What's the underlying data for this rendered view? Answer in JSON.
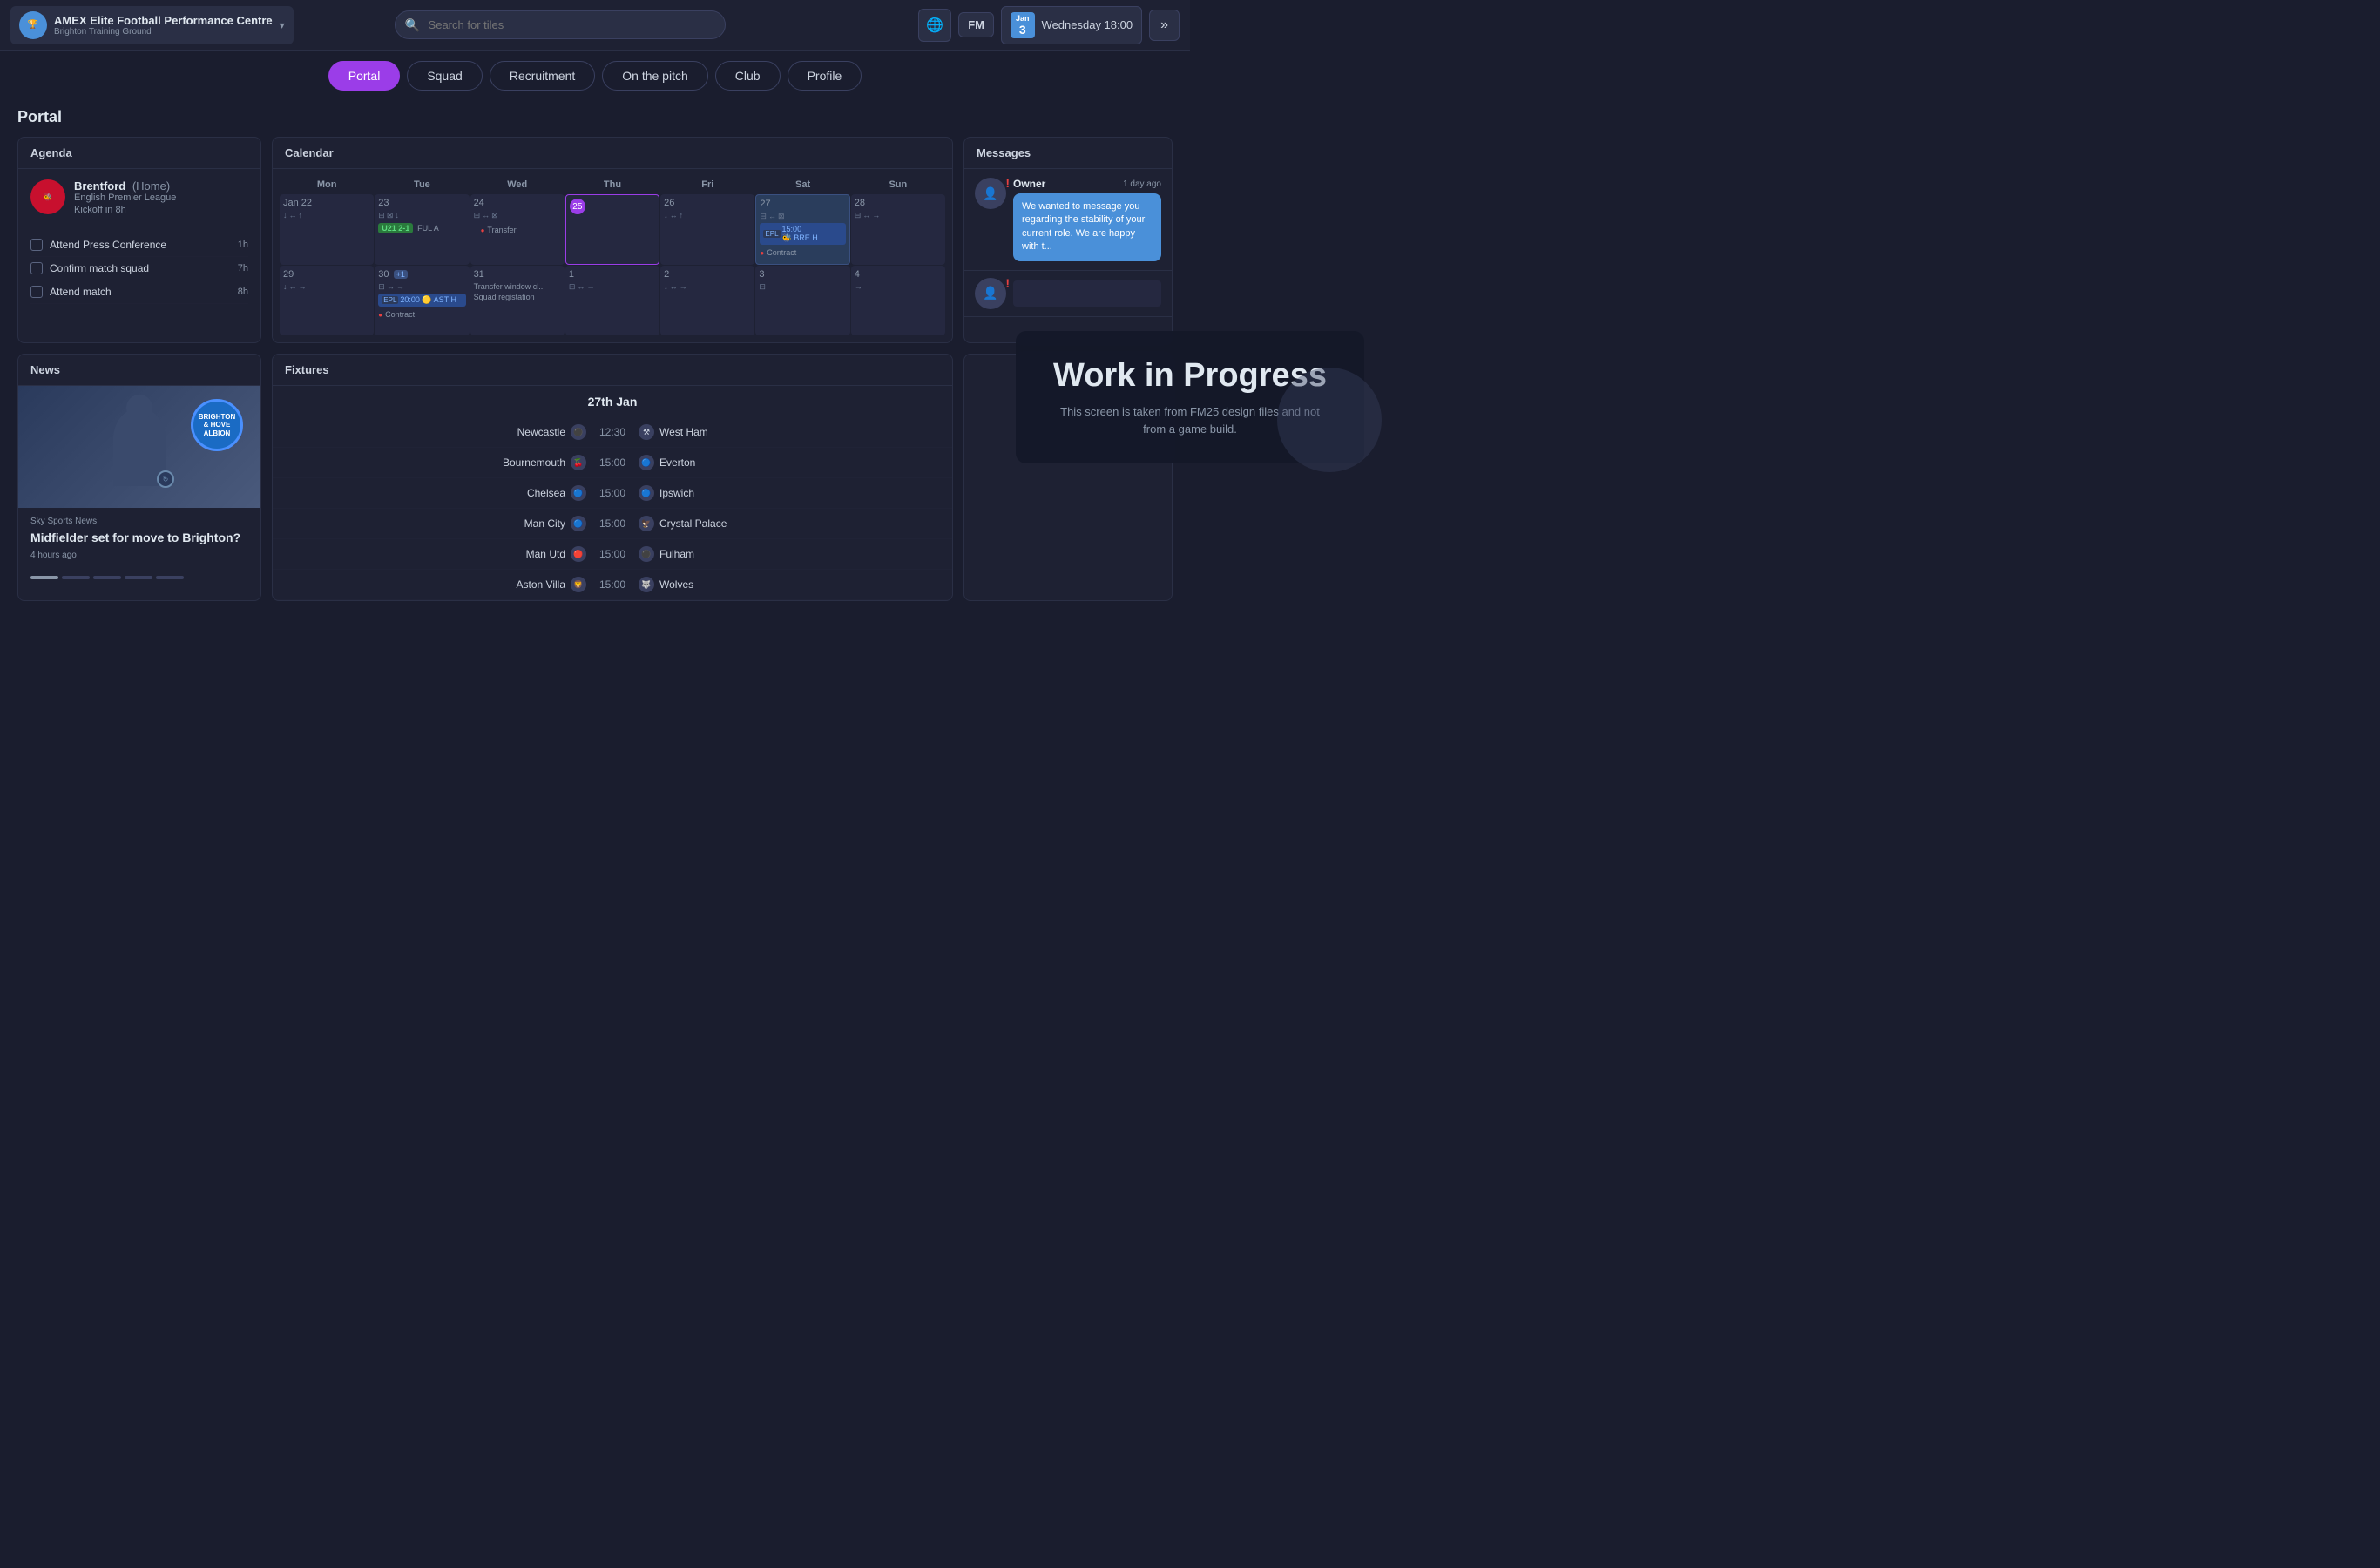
{
  "topbar": {
    "club_name": "AMEX Elite Football Performance Centre",
    "club_ground": "Brighton Training Ground",
    "search_placeholder": "Search for tiles",
    "date_month": "Jan",
    "date_day": "3",
    "date_text": "Wednesday 18:00",
    "fm_label": "FM",
    "advance_label": "»"
  },
  "nav": {
    "tabs": [
      {
        "id": "portal",
        "label": "Portal",
        "active": true
      },
      {
        "id": "squad",
        "label": "Squad",
        "active": false
      },
      {
        "id": "recruitment",
        "label": "Recruitment",
        "active": false
      },
      {
        "id": "on_the_pitch",
        "label": "On the pitch",
        "active": false
      },
      {
        "id": "club",
        "label": "Club",
        "active": false
      },
      {
        "id": "profile",
        "label": "Profile",
        "active": false
      }
    ]
  },
  "page_title": "Portal",
  "agenda": {
    "title": "Agenda",
    "match": {
      "team": "Brentford",
      "location": "(Home)",
      "league": "English Premier League",
      "kickoff": "Kickoff in 8h"
    },
    "tasks": [
      {
        "name": "Attend Press Conference",
        "time": "1h"
      },
      {
        "name": "Confirm match squad",
        "time": "7h"
      },
      {
        "name": "Attend match",
        "time": "8h"
      }
    ]
  },
  "calendar": {
    "title": "Calendar",
    "headers": [
      "Mon",
      "Tue",
      "Wed",
      "Thu",
      "Fri",
      "Sat",
      "Sun"
    ],
    "weeks": [
      {
        "days": [
          {
            "num": "Jan 22",
            "events": [],
            "icons": [
              "↓",
              "↔",
              "↑"
            ]
          },
          {
            "num": "23",
            "events": [],
            "icons": [
              "⊟",
              "⊠",
              "↓"
            ]
          },
          {
            "num": "24",
            "events": [],
            "icons": [
              "⊟",
              "↔",
              "⊠"
            ]
          },
          {
            "num": "25",
            "events": [],
            "today": true
          },
          {
            "num": "26",
            "icons": [
              "↓",
              "↔",
              "↑"
            ]
          },
          {
            "num": "27",
            "highlight": true,
            "events": [
              "EPL 15:00 BRE H",
              "Contract"
            ]
          },
          {
            "num": "28",
            "icons": [
              "⊟",
              "↔",
              "→"
            ]
          }
        ]
      },
      {
        "days": [
          {
            "num": "29",
            "icons": [
              "↓",
              "↔",
              "→"
            ]
          },
          {
            "num": "30",
            "badge": "+1",
            "icons": [
              "⊟",
              "↔",
              "→"
            ],
            "events": [
              "EPL 20:00 AST H",
              "Contract"
            ]
          },
          {
            "num": "31",
            "events": [
              "Transfer window cl...",
              "Squad registation"
            ]
          },
          {
            "num": "1",
            "icons": [
              "⊟",
              "↔",
              "→"
            ]
          },
          {
            "num": "2",
            "icons": [
              "↓",
              "↔",
              "→"
            ]
          },
          {
            "num": "3",
            "icons": [
              "⊟"
            ]
          },
          {
            "num": "4",
            "icons": [
              "→"
            ]
          }
        ]
      }
    ]
  },
  "messages": {
    "title": "Messages",
    "items": [
      {
        "sender": "Owner",
        "time": "1 day ago",
        "urgent": true,
        "preview": "We wanted to message you regarding the stability of your current role. We are happy with t..."
      },
      {
        "sender": "",
        "time": "",
        "urgent": true,
        "preview": ""
      }
    ]
  },
  "news": {
    "title": "News",
    "source": "Sky Sports News",
    "headline": "Midfielder set for move to Brighton?",
    "time": "4 hours ago",
    "club_badge": "BRIGHTON & HOVE ALBION"
  },
  "fixtures": {
    "title": "Fixtures",
    "date": "27th Jan",
    "matches": [
      {
        "home": "Newcastle",
        "time": "12:30",
        "away": "West Ham"
      },
      {
        "home": "Bournemouth",
        "time": "15:00",
        "away": "Everton"
      },
      {
        "home": "Chelsea",
        "time": "15:00",
        "away": "Ipswich"
      },
      {
        "home": "Man City",
        "time": "15:00",
        "away": "Crystal Palace"
      },
      {
        "home": "Man Utd",
        "time": "15:00",
        "away": "Fulham"
      },
      {
        "home": "Aston Villa",
        "time": "15:00",
        "away": "Wolves"
      }
    ]
  },
  "wip": {
    "title": "Work in Progress",
    "description": "This screen is taken from FM25 design files and not from a game build."
  }
}
